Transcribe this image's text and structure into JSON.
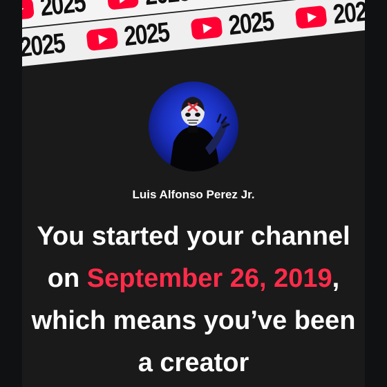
{
  "banner": {
    "year_label": "2025",
    "logo_color": "#ff0033",
    "logo_icon": "youtube-play-icon"
  },
  "profile": {
    "avatar_icon": "avatar",
    "channel_name": "Luis Alfonso Perez Jr."
  },
  "message": {
    "lead": "You started your channel on ",
    "highlight": "September 26, 2019",
    "trail": ", which means you’ve been a creator",
    "highlight_color": "#ff2b49"
  }
}
